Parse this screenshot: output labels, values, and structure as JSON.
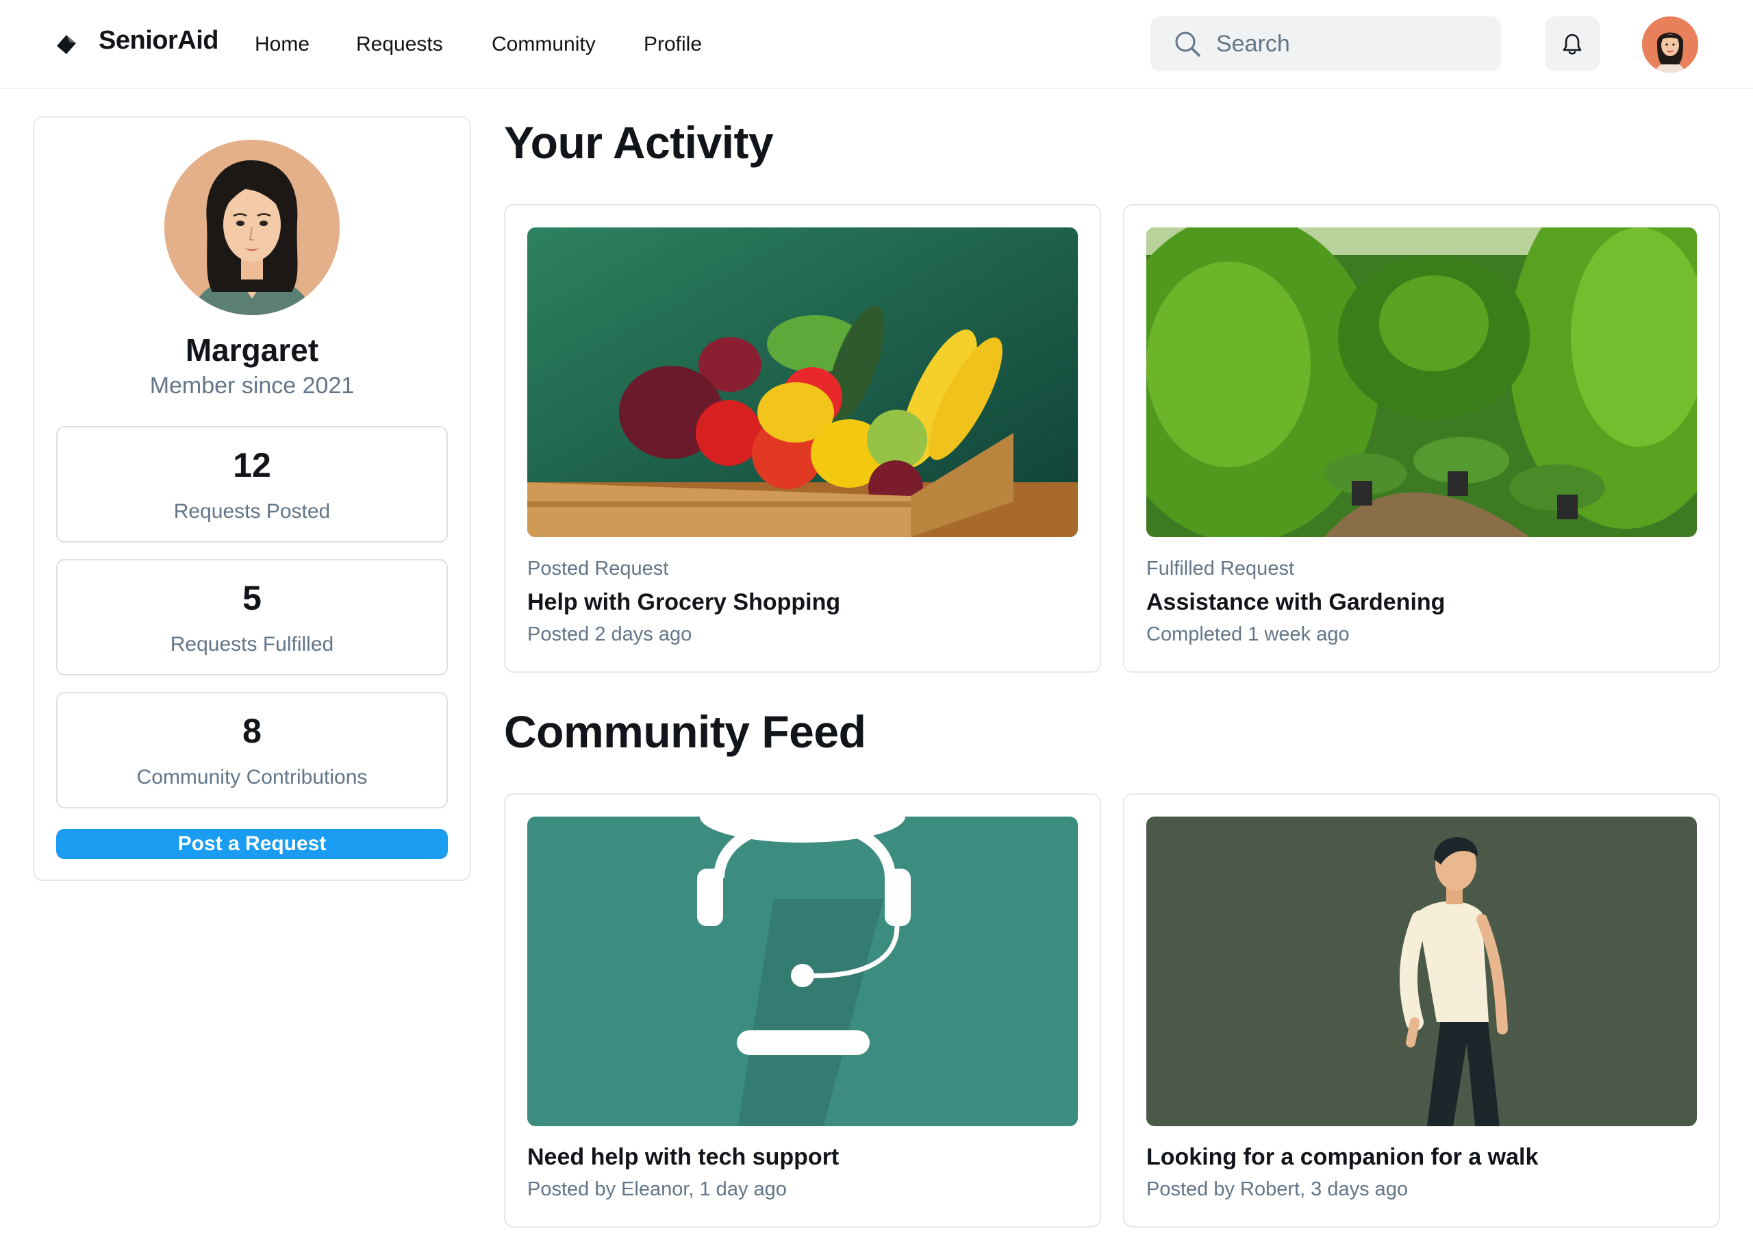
{
  "brand": {
    "name": "SeniorAid"
  },
  "nav": [
    {
      "label": "Home"
    },
    {
      "label": "Requests"
    },
    {
      "label": "Community"
    },
    {
      "label": "Profile"
    }
  ],
  "search": {
    "placeholder": "Search",
    "value": ""
  },
  "icons": {
    "logo": "diamond-logo-icon",
    "search": "search-icon",
    "notifications": "bell-icon"
  },
  "profile": {
    "name": "Margaret",
    "member_since": "Member since 2021",
    "stats": [
      {
        "value": "12",
        "label": "Requests Posted"
      },
      {
        "value": "5",
        "label": "Requests Fulfilled"
      },
      {
        "value": "8",
        "label": "Community Contributions"
      }
    ],
    "post_button": "Post a Request"
  },
  "activity": {
    "title": "Your Activity",
    "cards": [
      {
        "kicker": "Posted Request",
        "title": "Help with Grocery Shopping",
        "meta": "Posted 2 days ago",
        "image": "grocery-produce-crate"
      },
      {
        "kicker": "Fulfilled Request",
        "title": "Assistance with Gardening",
        "meta": "Completed 1 week ago",
        "image": "garden-hedges"
      }
    ]
  },
  "feed": {
    "title": "Community Feed",
    "cards": [
      {
        "title": "Need help with tech support",
        "meta": "Posted by Eleanor, 1 day ago",
        "image": "headset-illustration"
      },
      {
        "title": "Looking for a companion for a walk",
        "meta": "Posted by Robert, 3 days ago",
        "image": "walking-man-illustration"
      }
    ]
  },
  "colors": {
    "accent": "#1a9cf0",
    "text_primary": "#111418",
    "text_secondary": "#637588",
    "border": "#e6e8eb",
    "search_bg": "#f0f2f4"
  }
}
